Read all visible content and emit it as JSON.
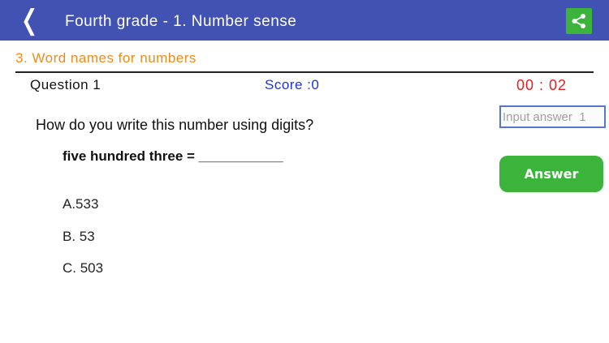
{
  "header": {
    "back_glyph": "❬",
    "title": "Fourth grade - 1. Number sense",
    "share_icon": "share-icon",
    "colors": {
      "bar": "#4152b3",
      "share_button": "#3cb43c"
    }
  },
  "section": {
    "title": "3. Word names for numbers",
    "color": "#f08a1a"
  },
  "status": {
    "question_label": "Question  1",
    "score_label": "Score :0",
    "timer": "00 : 02",
    "colors": {
      "score": "#1a32e0",
      "timer": "#e02020"
    }
  },
  "question": {
    "prompt": "How do you write this number using digits?",
    "problem": "five hundred three = ___________",
    "options": [
      "A.533",
      "B. 53",
      "C. 503"
    ]
  },
  "answer": {
    "placeholder": "Input answer  1",
    "value": "",
    "button_label": "Answer",
    "button_color": "#3cb43c"
  }
}
